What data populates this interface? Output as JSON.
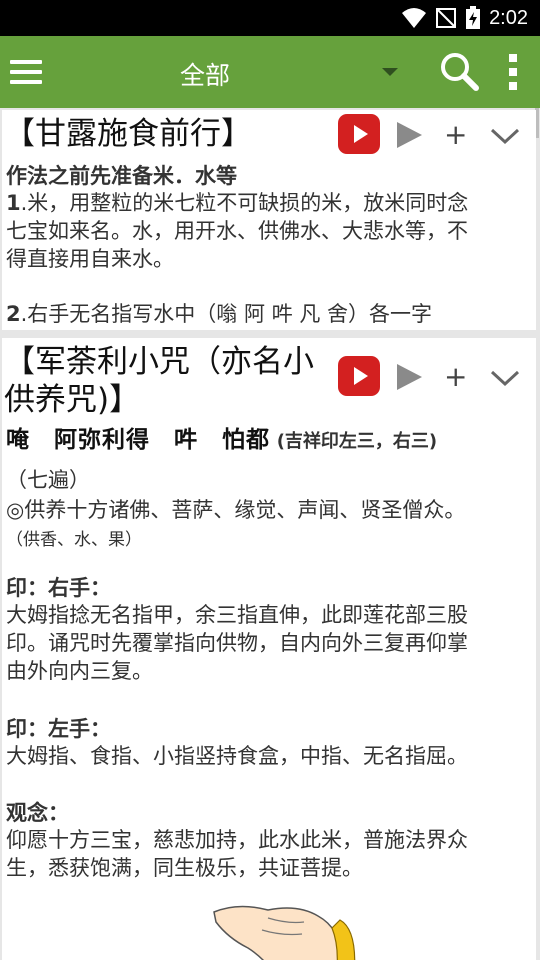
{
  "status": {
    "time": "2:02"
  },
  "app_bar": {
    "title": "全部",
    "search_icon": "search-icon",
    "menu_icon": "hamburger-menu-icon",
    "more_icon": "more-vert-icon",
    "accent": "#66a13c"
  },
  "cards": [
    {
      "title": "【甘露施食前行】",
      "lines": [
        {
          "bold": "作法之前先准备米．水等",
          "rest": ""
        },
        {
          "bold": "1",
          "rest": ".米，用整粒的米七粒不可缺损的米，放米同时念"
        },
        {
          "bold": "",
          "rest": "七宝如来名。水，用开水、供佛水、大悲水等，不"
        },
        {
          "bold": "",
          "rest": "得直接用自来水。"
        },
        {
          "bold": "2",
          "rest": ".右手无名指写水中（嗡 阿 吽 凡 舍）各一字"
        }
      ]
    },
    {
      "title_line1": "【军荼利小咒（亦名小",
      "title_line2": "供养咒)】",
      "mantra": "唵　阿弥利得　吽　怕都",
      "mantra_note": "(吉祥印左三，右三)",
      "repeat": "（七遍）",
      "offering": "◎供养十方诸佛、菩萨、缘觉、声闻、贤圣僧众。",
      "offering_note": "（供香、水、果）",
      "right_hand_label": "印：右手：",
      "right_hand_1": "大姆指捻无名指甲，余三指直伸，此即莲花部三股",
      "right_hand_2": "印。诵咒时先覆掌指向供物，自内向外三复再仰掌",
      "right_hand_3": "由外向内三复。",
      "left_hand_label": "印：左手：",
      "left_hand_1": "大姆指、食指、小指竖持食盒，中指、无名指屈。",
      "visualize_label": "观念：",
      "visualize_1": "仰愿十方三宝，慈悲加持，此水此米，普施法界众",
      "visualize_2": "生，悉获饱满，同生极乐，共证菩提。"
    }
  ]
}
